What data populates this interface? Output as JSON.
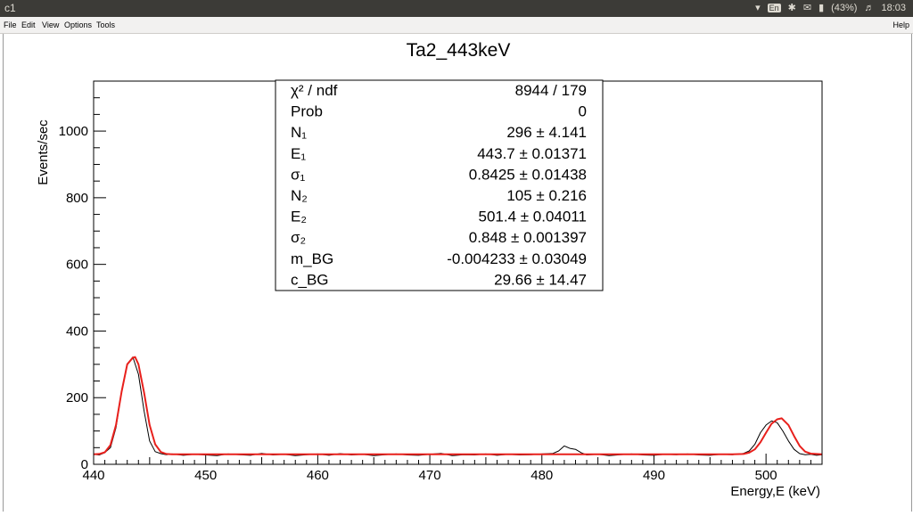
{
  "window": {
    "title": "c1"
  },
  "tray": {
    "keyboard": "En",
    "battery": "(43%)",
    "time": "18:03",
    "icons": [
      "wifi-icon",
      "keyboard-icon",
      "bluetooth-icon",
      "mail-icon",
      "battery-icon",
      "volume-icon"
    ]
  },
  "menu": {
    "file": "File",
    "edit": "Edit",
    "view": "View",
    "options": "Options",
    "tools": "Tools",
    "help": "Help"
  },
  "colors": {
    "data_line": "#000000",
    "fit_line": "#e8201c",
    "frame": "#000000"
  },
  "chart_data": {
    "type": "line",
    "title": "Ta2_443keV",
    "xlabel": "Energy,E (keV)",
    "ylabel": "Events/sec",
    "xlim": [
      440,
      505
    ],
    "ylim": [
      0,
      1150
    ],
    "xticks": [
      "440",
      "450",
      "460",
      "470",
      "480",
      "490",
      "500"
    ],
    "yticks": [
      "0",
      "200",
      "400",
      "600",
      "800",
      "1000"
    ],
    "series": [
      {
        "kind": "data",
        "x": [
          440.0,
          440.5,
          441.0,
          441.5,
          442.0,
          442.5,
          443.0,
          443.5,
          444.0,
          444.5,
          445.0,
          445.5,
          446.0,
          446.5,
          447.0,
          448.0,
          449.0,
          450.0,
          451.0,
          452.0,
          453.0,
          454.0,
          455.0,
          456.0,
          457.0,
          458.0,
          459.0,
          460.0,
          461.0,
          462.0,
          463.0,
          464.0,
          465.0,
          466.0,
          467.0,
          468.0,
          469.0,
          470.0,
          471.0,
          472.0,
          473.0,
          474.0,
          475.0,
          476.0,
          477.0,
          478.0,
          479.0,
          480.0,
          481.0,
          481.5,
          482.0,
          482.5,
          483.0,
          483.5,
          484.0,
          485.0,
          486.0,
          487.0,
          488.0,
          489.0,
          490.0,
          491.0,
          492.0,
          493.0,
          494.0,
          495.0,
          496.0,
          497.0,
          498.0,
          498.5,
          499.0,
          499.5,
          500.0,
          500.5,
          501.0,
          501.5,
          502.0,
          502.5,
          503.0,
          503.5,
          504.0,
          504.5,
          505.0
        ],
        "y": [
          30,
          28,
          35,
          50,
          110,
          220,
          300,
          322,
          270,
          160,
          70,
          38,
          32,
          29,
          31,
          27,
          30,
          28,
          26,
          31,
          29,
          27,
          33,
          28,
          30,
          26,
          29,
          31,
          27,
          32,
          28,
          30,
          26,
          29,
          31,
          28,
          27,
          30,
          33,
          26,
          29,
          28,
          31,
          27,
          30,
          28,
          29,
          31,
          33,
          40,
          55,
          48,
          45,
          35,
          28,
          30,
          26,
          29,
          31,
          28,
          27,
          30,
          29,
          31,
          28,
          27,
          30,
          29,
          33,
          40,
          60,
          95,
          118,
          130,
          125,
          100,
          70,
          45,
          32,
          29,
          30,
          27,
          29
        ]
      },
      {
        "kind": "fit",
        "x": [
          440.0,
          440.5,
          441.0,
          441.5,
          442.0,
          442.5,
          443.0,
          443.5,
          443.7,
          444.0,
          444.5,
          445.0,
          445.5,
          446.0,
          446.5,
          447.0,
          450.0,
          455.0,
          460.0,
          465.0,
          470.0,
          475.0,
          480.0,
          485.0,
          490.0,
          495.0,
          497.0,
          498.0,
          498.5,
          499.0,
          499.5,
          500.0,
          500.5,
          501.0,
          501.4,
          502.0,
          502.5,
          503.0,
          503.5,
          504.0,
          505.0
        ],
        "y": [
          30,
          31,
          36,
          58,
          118,
          218,
          300,
          320,
          322,
          300,
          215,
          118,
          60,
          37,
          31,
          30,
          30,
          30,
          30,
          30,
          30,
          30,
          30,
          30,
          30,
          30,
          30,
          31,
          35,
          45,
          66,
          95,
          122,
          135,
          138,
          118,
          85,
          55,
          38,
          32,
          30
        ]
      }
    ],
    "stats": [
      {
        "label": "χ² / ndf",
        "value": "8944 / 179"
      },
      {
        "label": "Prob",
        "value": "0"
      },
      {
        "label": "N₁",
        "value": "296 ± 4.141"
      },
      {
        "label": "E₁",
        "value": "443.7 ± 0.01371"
      },
      {
        "label": "σ₁",
        "value": "0.8425 ± 0.01438"
      },
      {
        "label": "N₂",
        "value": "105 ± 0.216"
      },
      {
        "label": "E₂",
        "value": "501.4 ± 0.04011"
      },
      {
        "label": "σ₂",
        "value": "0.848 ± 0.001397"
      },
      {
        "label": "m_BG",
        "value": "-0.004233 ± 0.03049"
      },
      {
        "label": "c_BG",
        "value": "29.66 ± 14.47"
      }
    ]
  }
}
